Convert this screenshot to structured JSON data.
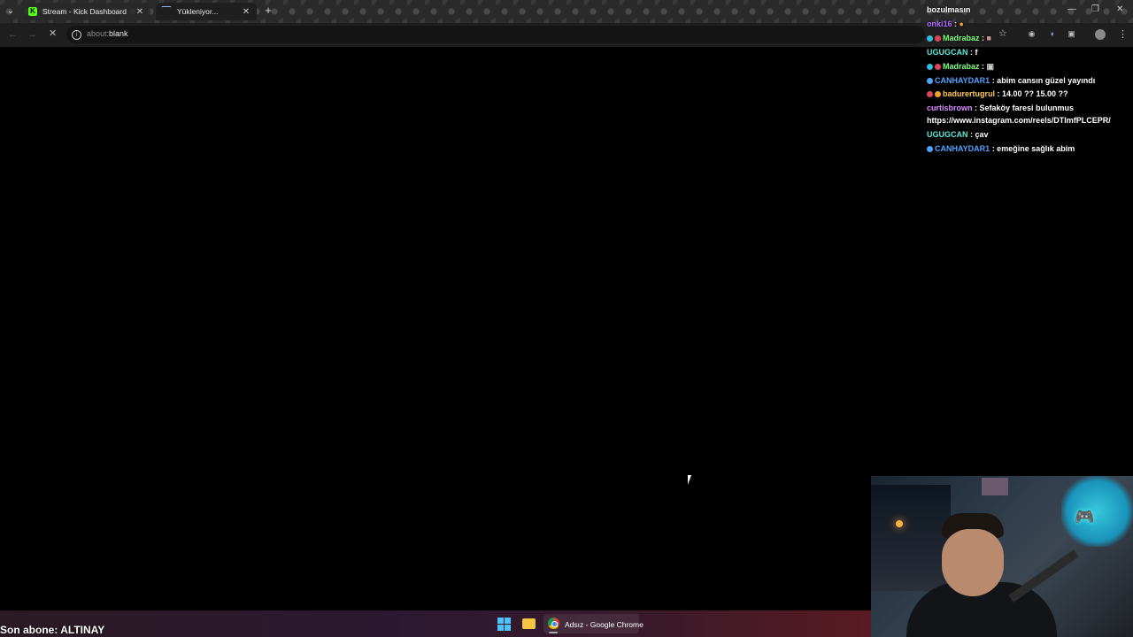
{
  "browser": {
    "tabs": [
      {
        "title": "Stream - Kick Dashboard",
        "favicon": "kick-icon",
        "active": false
      },
      {
        "title": "Yükleniyor...",
        "favicon": "loading-spinner-icon",
        "active": true
      }
    ],
    "address": {
      "scheme": "about:",
      "path": "blank"
    }
  },
  "chat": {
    "messages": [
      {
        "user": "",
        "text": "bozulmasın",
        "color": "#ffffff"
      },
      {
        "user": "onki16",
        "text": " : ",
        "color": "#b36bff"
      },
      {
        "user": "Madrabaz",
        "text": " : ",
        "color": "#7fff7f"
      },
      {
        "user": "UGUGCAN",
        "text": " : f",
        "color": "#5fe8d8"
      },
      {
        "user": "Madrabaz",
        "text": " : ",
        "color": "#7fff7f"
      },
      {
        "user": "CANHAYDAR1",
        "text": " : abim cansın güzel yayındı",
        "color": "#4fa3ff"
      },
      {
        "user": "badurertugrul",
        "text": " : 14.00 ?? 15.00 ??",
        "color": "#ffc94d"
      },
      {
        "user": "curtisbrown",
        "text": " : Sefaköy faresi bulunmus",
        "color": "#d88cff"
      },
      {
        "user": "",
        "text": "https://www.instagram.com/reels/DTImfPLCEPR/",
        "color": "#ffffff"
      },
      {
        "user": "UGUGCAN",
        "text": " : çav",
        "color": "#5fe8d8"
      },
      {
        "user": "CANHAYDAR1",
        "text": " : emeğine sağlık abim",
        "color": "#4fa3ff"
      }
    ]
  },
  "overlay": {
    "last_subscriber": "Son abone: ALTINAY"
  },
  "taskbar": {
    "chrome_window": "Adsız - Google Chrome"
  }
}
